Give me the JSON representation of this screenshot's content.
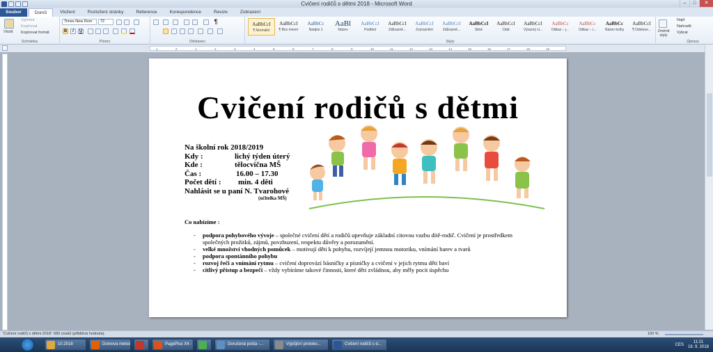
{
  "window": {
    "title": "Cvičení rodičů s dětmi 2018 - Microsoft Word",
    "minimize": "–",
    "maximize": "□",
    "close": "✕"
  },
  "ribbon_tabs": [
    "Soubor",
    "Domů",
    "Vložení",
    "Rozložení stránky",
    "Reference",
    "Korespondence",
    "Revize",
    "Zobrazení"
  ],
  "clipboard": {
    "paste": "Vložit",
    "cut": "Vyjmout",
    "copy": "Kopírovat",
    "format_painter": "Kopírovat formát",
    "label": "Schránka"
  },
  "font": {
    "name": "Times New Rom",
    "size": "72",
    "label": "Písmo",
    "bold": "B",
    "italic": "I",
    "underline": "U"
  },
  "paragraph": {
    "label": "Odstavec",
    "pilcrow": "¶"
  },
  "styles": {
    "label": "Styly",
    "items": [
      {
        "preview": "AaBbCcI",
        "name": "¶ Normální"
      },
      {
        "preview": "AaBbCcI",
        "name": "¶ Bez mezer"
      },
      {
        "preview": "AaBbCc",
        "name": "Nadpis 1"
      },
      {
        "preview": "AaBl",
        "name": "Název"
      },
      {
        "preview": "AaBbCcI",
        "name": "Podtitul"
      },
      {
        "preview": "AaBbCcI",
        "name": "Zdůrazně..."
      },
      {
        "preview": "AaBbCcI",
        "name": "Zvýraznění"
      },
      {
        "preview": "AaBbCcI",
        "name": "Zdůrazně..."
      },
      {
        "preview": "AaBbCcI",
        "name": "Silné"
      },
      {
        "preview": "AaBbCcI",
        "name": "Citát"
      },
      {
        "preview": "AaBbCcI",
        "name": "Výrazný ci..."
      },
      {
        "preview": "AaBbCc",
        "name": "Odkaz – j..."
      },
      {
        "preview": "AaBbCc",
        "name": "Odkaz – i..."
      },
      {
        "preview": "AaBbCc",
        "name": "Název knihy"
      },
      {
        "preview": "AaBbCcI",
        "name": "¶ Odstave..."
      }
    ],
    "change": "Změnit styly"
  },
  "editing": {
    "label": "Úpravy",
    "find": "Najít",
    "replace": "Nahradit",
    "select": "Vybrat"
  },
  "ruler_ticks": [
    "1",
    "2",
    "1",
    "2",
    "3",
    "4",
    "5",
    "6",
    "7",
    "8",
    "9",
    "10",
    "11",
    "12",
    "13",
    "14",
    "15",
    "16",
    "17",
    "18",
    "19"
  ],
  "document": {
    "title": "Cvičení rodičů s dětmi",
    "info": [
      {
        "label": "Na školní rok 2018/2019",
        "value": ""
      },
      {
        "label": "Kdy :",
        "value": "lichý týden úterý"
      },
      {
        "label": "Kde :",
        "value": "tělocvična MŠ"
      },
      {
        "label": "Čas :",
        "value": "16.00 – 17.30"
      },
      {
        "label": "Počet dětí :",
        "value": "min. 4 děti"
      },
      {
        "label": "Nahlásit se u paní N. Tvarohové",
        "value": ""
      }
    ],
    "info_note": "(učitelka MŠ)",
    "offer_heading": "Co nabízíme :",
    "offers": [
      {
        "bold": "podpora pohybového vývoje",
        "text": " – společné cvičení dětí a rodičů upevňuje základní citovou vazbu dítě-rodič. Cvičení je prostředkem společných prožitků, zájmů, povzbuzení, respektu důvěry a porozumění."
      },
      {
        "bold": "velké množství vhodných pomůcek",
        "text": " – motivují děti k pohybu, rozvíjejí jemnou motoriku, vnímání barev a tvarů"
      },
      {
        "bold": "podpora spontánního pohybu",
        "text": ""
      },
      {
        "bold": "rozvoj řeči a vnímání rytmu",
        "text": " – cvičení doprovází básničky a písničky a cvičení v jejich rytmu děti baví"
      },
      {
        "bold": "citlivý přístup a bezpečí",
        "text": " – vždy vybíráme takové činnosti, které děti zvládnou, aby měly pocit úspěchu"
      }
    ]
  },
  "status_bar": {
    "text": "'Cvičení rodičů s dětmi 2018': 689 znaků (přibližná hodnota).",
    "zoom": "100 %"
  },
  "taskbar": {
    "buttons": [
      {
        "label": "10.2018",
        "color": "#e0a83a"
      },
      {
        "label": "Domova metoda |...",
        "color": "#e66000"
      },
      {
        "label": "",
        "color": "#c0392b"
      },
      {
        "label": "PagePlus X4 - [Cv...",
        "color": "#d9531e"
      },
      {
        "label": "",
        "color": "#4caf50"
      },
      {
        "label": "Doručená pošta -...",
        "color": "#5d8fc4"
      },
      {
        "label": "Výpůjční protoko...",
        "color": "#8a8a8a"
      },
      {
        "label": "Cvičení rodičů s d...",
        "color": "#2b5797"
      }
    ],
    "lang": "CES",
    "time": "11:21",
    "date": "19. 9. 2018"
  }
}
